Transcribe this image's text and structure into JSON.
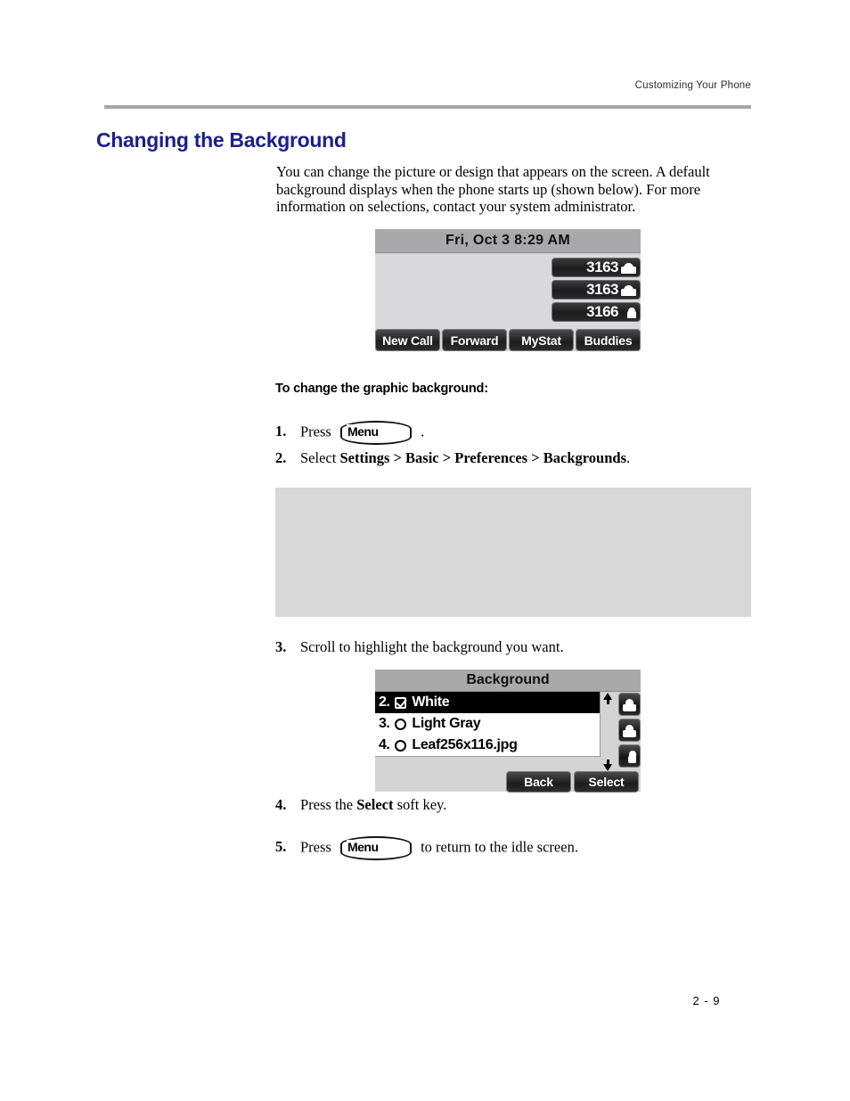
{
  "header": {
    "running_head": "Customizing Your Phone"
  },
  "section": {
    "title": "Changing the Background",
    "intro": "You can change the picture or design that appears on the screen. A default background displays when the phone starts up (shown below). For more information on selections, contact your system administrator.",
    "subhead": "To change the graphic background:"
  },
  "idle_screen": {
    "title": "Fri, Oct 3   8:29 AM",
    "line_keys": [
      {
        "number": "3163",
        "icon": "handset-icon"
      },
      {
        "number": "3163",
        "icon": "handset-icon"
      },
      {
        "number": "3166",
        "icon": "handset-half-icon"
      }
    ],
    "soft_keys": [
      "New Call",
      "Forward",
      "MyStat",
      "Buddies"
    ]
  },
  "steps": [
    {
      "num": "1.",
      "pre": "Press",
      "key": "Menu",
      "post": "."
    },
    {
      "num": "2.",
      "text_before": "Select ",
      "bold": "Settings > Basic > Preferences > Backgrounds",
      "text_after": "."
    },
    {
      "num": "3.",
      "text": "Scroll to highlight the background you want."
    },
    {
      "num": "4.",
      "text_before": "Press the ",
      "bold": "Select",
      "text_after": " soft key."
    },
    {
      "num": "5.",
      "pre": "Press",
      "key": "Menu",
      "post": "to return to the idle screen."
    }
  ],
  "background_screen": {
    "title": "Background",
    "rows": [
      {
        "index": "2.",
        "name": "White",
        "checked": true,
        "selected": true
      },
      {
        "index": "3.",
        "name": "Light Gray",
        "checked": false,
        "selected": false
      },
      {
        "index": "4.",
        "name": "Leaf256x116.jpg",
        "checked": false,
        "selected": false
      }
    ],
    "scroll_up_icon": "arrow-up-icon",
    "scroll_down_icon": "arrow-down-icon",
    "soft_keys": [
      "Back",
      "Select"
    ]
  },
  "footer": {
    "page_number": "2 - 9"
  }
}
